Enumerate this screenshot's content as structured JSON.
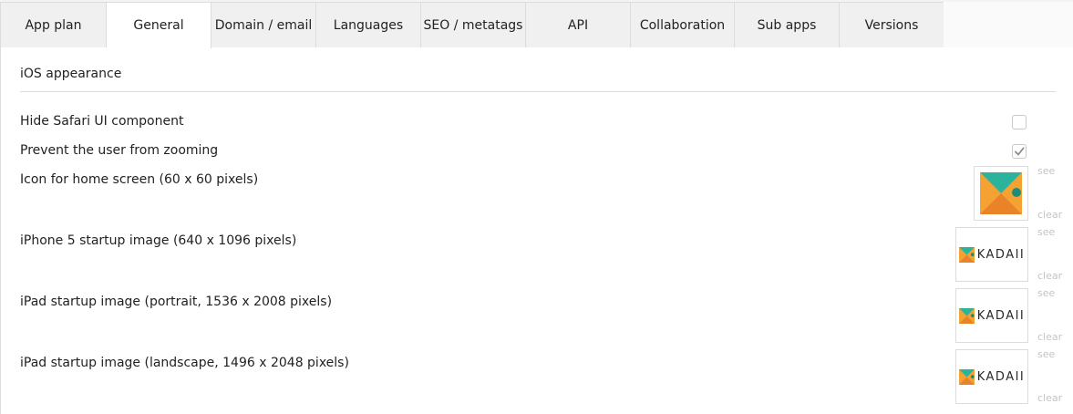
{
  "tabs": [
    {
      "label": "App plan",
      "active": false
    },
    {
      "label": "General",
      "active": true
    },
    {
      "label": "Domain / email",
      "active": false
    },
    {
      "label": "Languages",
      "active": false
    },
    {
      "label": "SEO / metatags",
      "active": false
    },
    {
      "label": "API",
      "active": false
    },
    {
      "label": "Collaboration",
      "active": false
    },
    {
      "label": "Sub apps",
      "active": false
    },
    {
      "label": "Versions",
      "active": false
    }
  ],
  "section": {
    "title": "iOS appearance"
  },
  "settings": {
    "hide_safari": {
      "label": "Hide Safari UI component",
      "checked": false
    },
    "prevent_zoom": {
      "label": "Prevent the user from zooming",
      "checked": true
    }
  },
  "images": {
    "see_label": "see",
    "clear_label": "clear",
    "brand_text": "KADAII",
    "items": [
      {
        "label": "Icon for home screen (60 x 60 pixels)"
      },
      {
        "label": "iPhone 5 startup image (640 x 1096 pixels)"
      },
      {
        "label": "iPad startup image (portrait, 1536 x 2008 pixels)"
      },
      {
        "label": "iPad startup image (landscape, 1496 x 2048 pixels)"
      }
    ]
  },
  "colors": {
    "logo_orange": "#f4a233",
    "logo_dark_orange": "#e8832a",
    "logo_teal": "#2bb39b",
    "logo_dark_teal": "#1d8c78",
    "link_gray": "#c4c4c4"
  }
}
